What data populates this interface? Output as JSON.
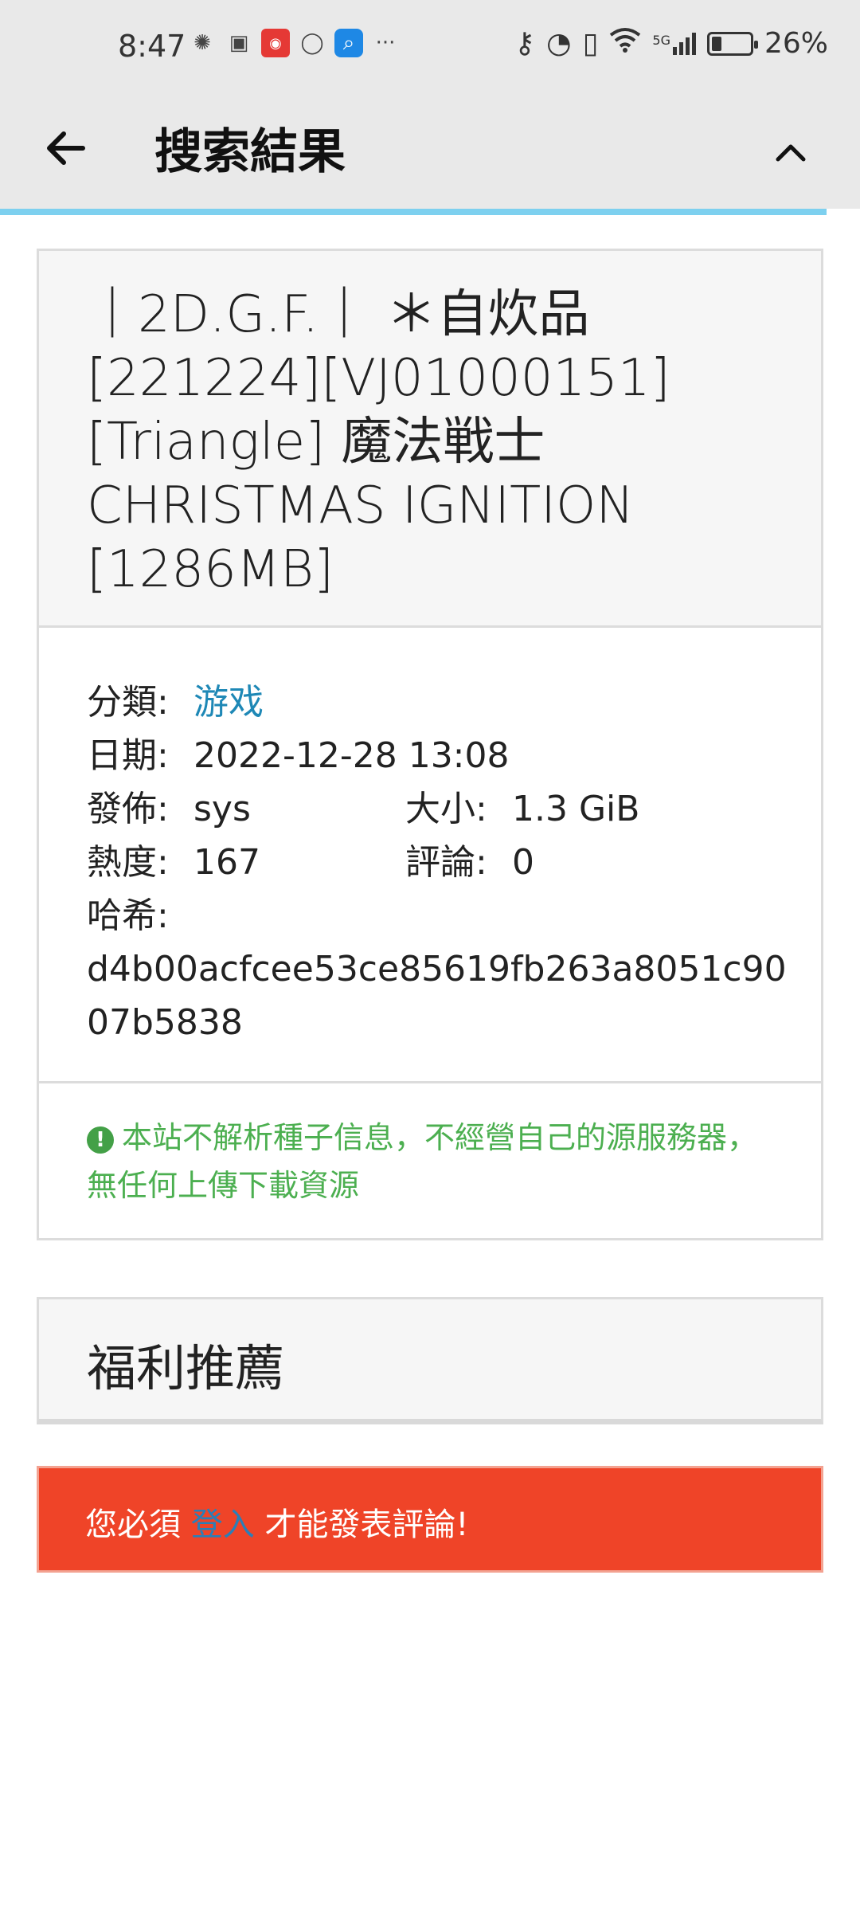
{
  "status_bar": {
    "time": "8:47",
    "battery_text": "26%",
    "battery_level": 0.26,
    "network": "5G",
    "more": "···"
  },
  "app_bar": {
    "title": "搜索結果",
    "back_icon": "arrow-left-icon",
    "collapse_icon": "chevron-up-icon"
  },
  "detail": {
    "title": "｜2D.G.F.｜ ＊自炊品 [221224][VJ01000151][Triangle] 魔法戦士 CHRISTMAS IGNITION [1286MB]",
    "category_label": "分類:",
    "category_value": "游戏",
    "date_label": "日期:",
    "date_value": "2022-12-28 13:08",
    "publisher_label": "發佈:",
    "publisher_value": "sys",
    "size_label": "大小:",
    "size_value": "1.3 GiB",
    "heat_label": "熱度:",
    "heat_value": "167",
    "comments_label": "評論:",
    "comments_value": "0",
    "hash_label": "哈希:",
    "hash_value": "d4b00acfcee53ce85619fb263a8051c9007b5838",
    "notice": "本站不解析種子信息，不經營自己的源服務器，無任何上傳下載資源"
  },
  "welfare": {
    "title": "福利推薦"
  },
  "login_bar": {
    "prefix": "您必須",
    "link": "登入",
    "suffix": "才能發表評論!"
  },
  "colors": {
    "accent": "#1e88b6",
    "notice": "#4caf50",
    "login_bar": "#ef4428",
    "progress": "#7dd0ef"
  }
}
